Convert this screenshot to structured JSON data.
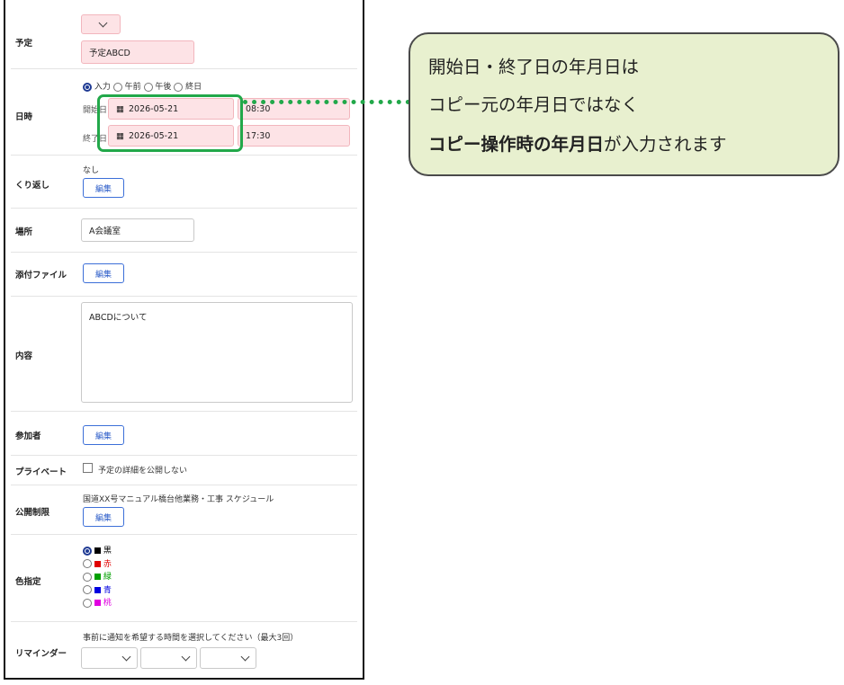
{
  "form": {
    "schedule": {
      "label": "予定",
      "title_value": "予定ABCD"
    },
    "datetime": {
      "label": "日時",
      "modes": [
        "入力",
        "午前",
        "午後",
        "終日"
      ],
      "selected_mode": "入力",
      "start_label": "開始日",
      "end_label": "終了日",
      "start_date": "2026-05-21",
      "start_time": "08:30",
      "end_date": "2026-05-21",
      "end_time": "17:30"
    },
    "repeat": {
      "label": "くり返し",
      "value": "なし",
      "edit": "編集"
    },
    "place": {
      "label": "場所",
      "value": "A会議室"
    },
    "attachment": {
      "label": "添付ファイル",
      "edit": "編集"
    },
    "content": {
      "label": "内容",
      "value": "ABCDについて"
    },
    "participants": {
      "label": "参加者",
      "edit": "編集"
    },
    "private": {
      "label": "プライベート",
      "checkbox_label": "予定の詳細を公開しない",
      "checked": false
    },
    "publish": {
      "label": "公開制限",
      "value": "国道XX号マニュアル橋台他業務・工事 スケジュール",
      "edit": "編集"
    },
    "color": {
      "label": "色指定",
      "options": [
        {
          "name": "黒",
          "color": "#000000",
          "selected": true
        },
        {
          "name": "赤",
          "color": "#e00000",
          "selected": false
        },
        {
          "name": "緑",
          "color": "#00a000",
          "selected": false
        },
        {
          "name": "青",
          "color": "#0000e0",
          "selected": false
        },
        {
          "name": "桃",
          "color": "#e000e0",
          "selected": false
        }
      ]
    },
    "reminder": {
      "label": "リマインダー",
      "hint": "事前に通知を希望する時間を選択してください（最大3回）"
    }
  },
  "callout": {
    "line1": "開始日・終了日の年月日は",
    "line2": "コピー元の年月日ではなく",
    "line3_bold": "コピー操作時の年月日",
    "line3_rest": "が入力されます"
  },
  "colors": {
    "highlight_green": "#22a84a",
    "callout_bg": "#e8f0cf",
    "pink_field": "#fde3e6"
  },
  "icons": {
    "calendar": "calendar-icon",
    "dropdown": "chevron-down-icon"
  }
}
